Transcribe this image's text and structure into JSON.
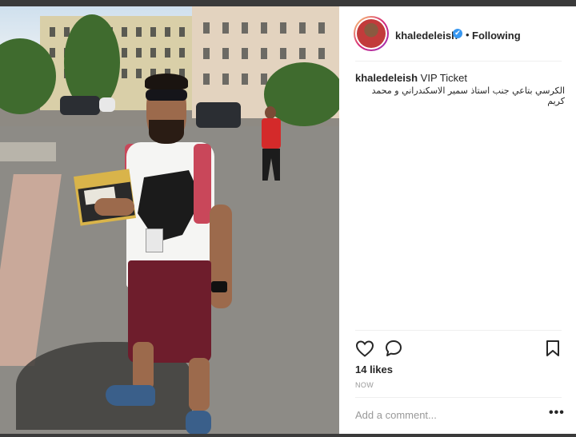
{
  "post": {
    "username": "khaledeleish",
    "follow_label": "Following",
    "separator": "•",
    "verified_glyph": "✔",
    "caption_title": "VIP Ticket",
    "caption_arabic": "الكرسي بتاعي جنب استاذ سمير الاسكندراني و محمد كريم",
    "likes": "14 likes",
    "timestamp": "NOW",
    "more_glyph": "•••"
  },
  "comment": {
    "placeholder": "Add a comment..."
  },
  "icons": {
    "like": "heart-icon",
    "comment": "comment-icon",
    "save": "bookmark-icon",
    "verified": "verified-badge-icon",
    "more": "more-options-icon"
  },
  "colors": {
    "verified_blue": "#3897f0",
    "text": "#262626",
    "muted": "#999999",
    "divider": "#efefef"
  }
}
